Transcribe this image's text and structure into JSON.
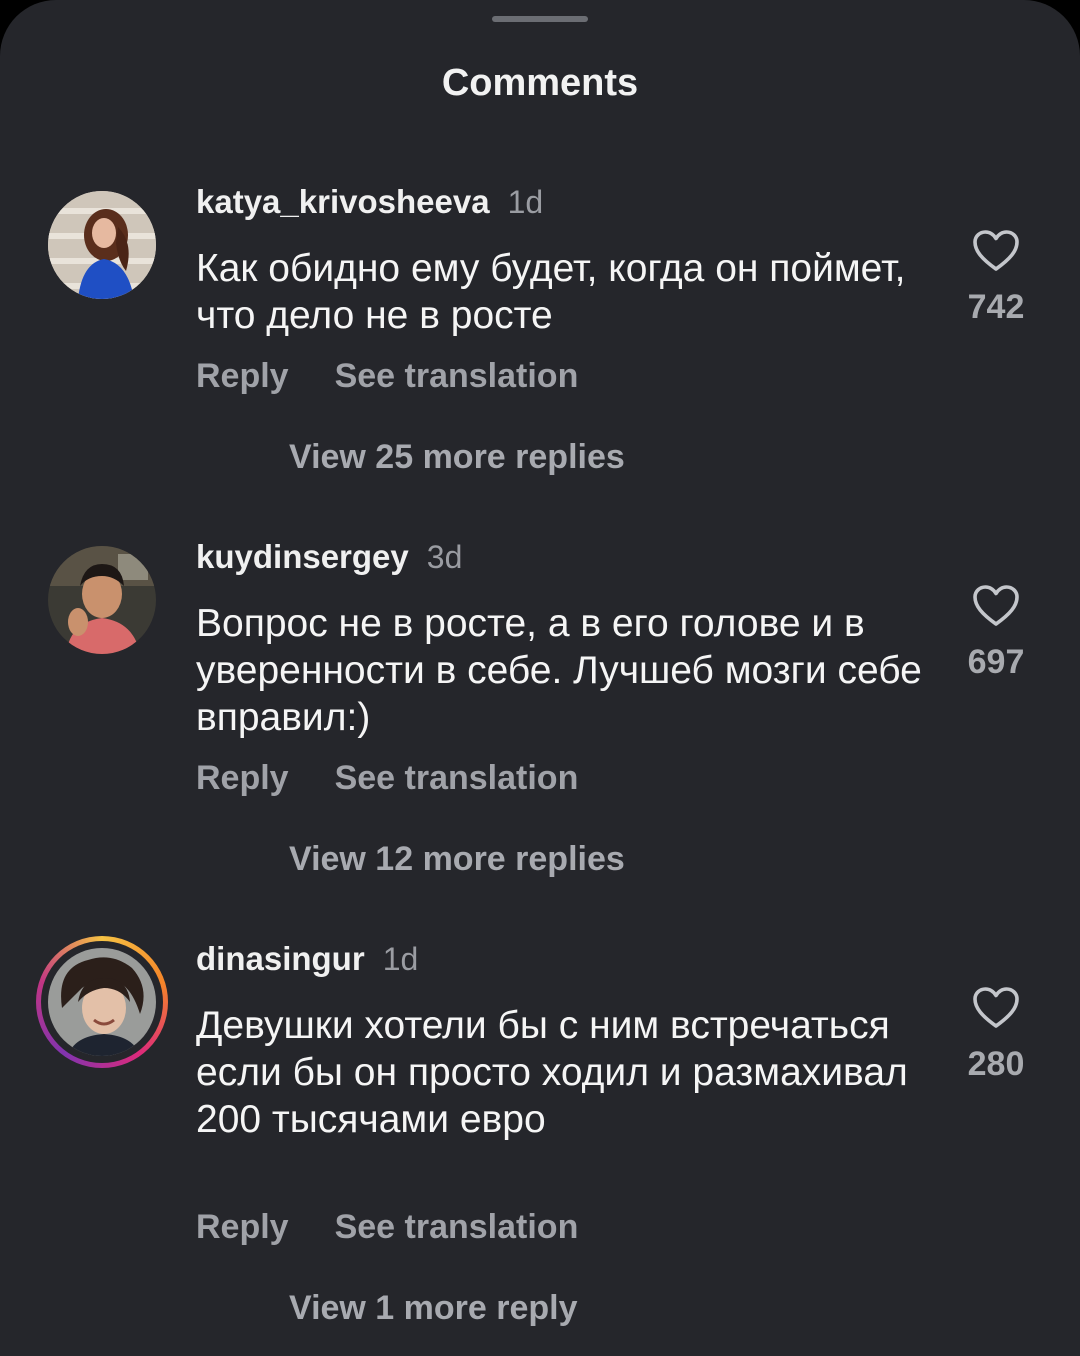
{
  "sheet": {
    "title": "Comments"
  },
  "comments": [
    {
      "username": "katya_krivosheeva",
      "time": "1d",
      "text": "Как обидно ему будет, когда он поймет, что дело не в росте",
      "likes": "742",
      "reply_label": "Reply",
      "translate_label": "See translation",
      "replies_label": "View 25 more replies"
    },
    {
      "username": "kuydinsergey",
      "time": "3d",
      "text": "Вопрос не в росте, а в его голове и в уверенности в себе. Лучшеб мозги себе вправил:)",
      "likes": "697",
      "reply_label": "Reply",
      "translate_label": "See translation",
      "replies_label": "View 12 more replies"
    },
    {
      "username": "dinasingur",
      "time": "1d",
      "text": "Девушки хотели бы с ним встречаться если бы он просто ходил и размахивал 200 тысячами евро",
      "likes": "280",
      "reply_label": "Reply",
      "translate_label": "See translation",
      "replies_label": "View 1 more reply"
    }
  ],
  "colors": {
    "background": "#25262b",
    "primary_text": "#f5f5f5",
    "secondary_text": "#a0a2a8",
    "story_ring": [
      "#f6c244",
      "#f58529",
      "#dd2a7b",
      "#8134af"
    ]
  },
  "icons": {
    "like": "heart-outline-icon"
  }
}
